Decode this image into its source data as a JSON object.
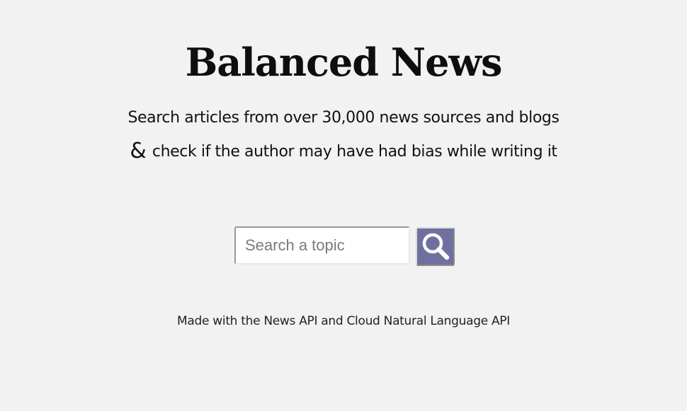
{
  "page": {
    "title": "Balanced News",
    "tagline_line1": "Search articles from over 30,000 news sources and blogs",
    "tagline_ampersand": "&",
    "tagline_line2": "check if the author may have had bias while writing it"
  },
  "search": {
    "placeholder": "Search a topic",
    "value": "",
    "button_icon": "search-icon",
    "button_color": "#7070a0"
  },
  "footer": {
    "credit": "Made with the News API and Cloud Natural Language API"
  },
  "colors": {
    "background": "#f2f2f2",
    "text": "#111111"
  }
}
